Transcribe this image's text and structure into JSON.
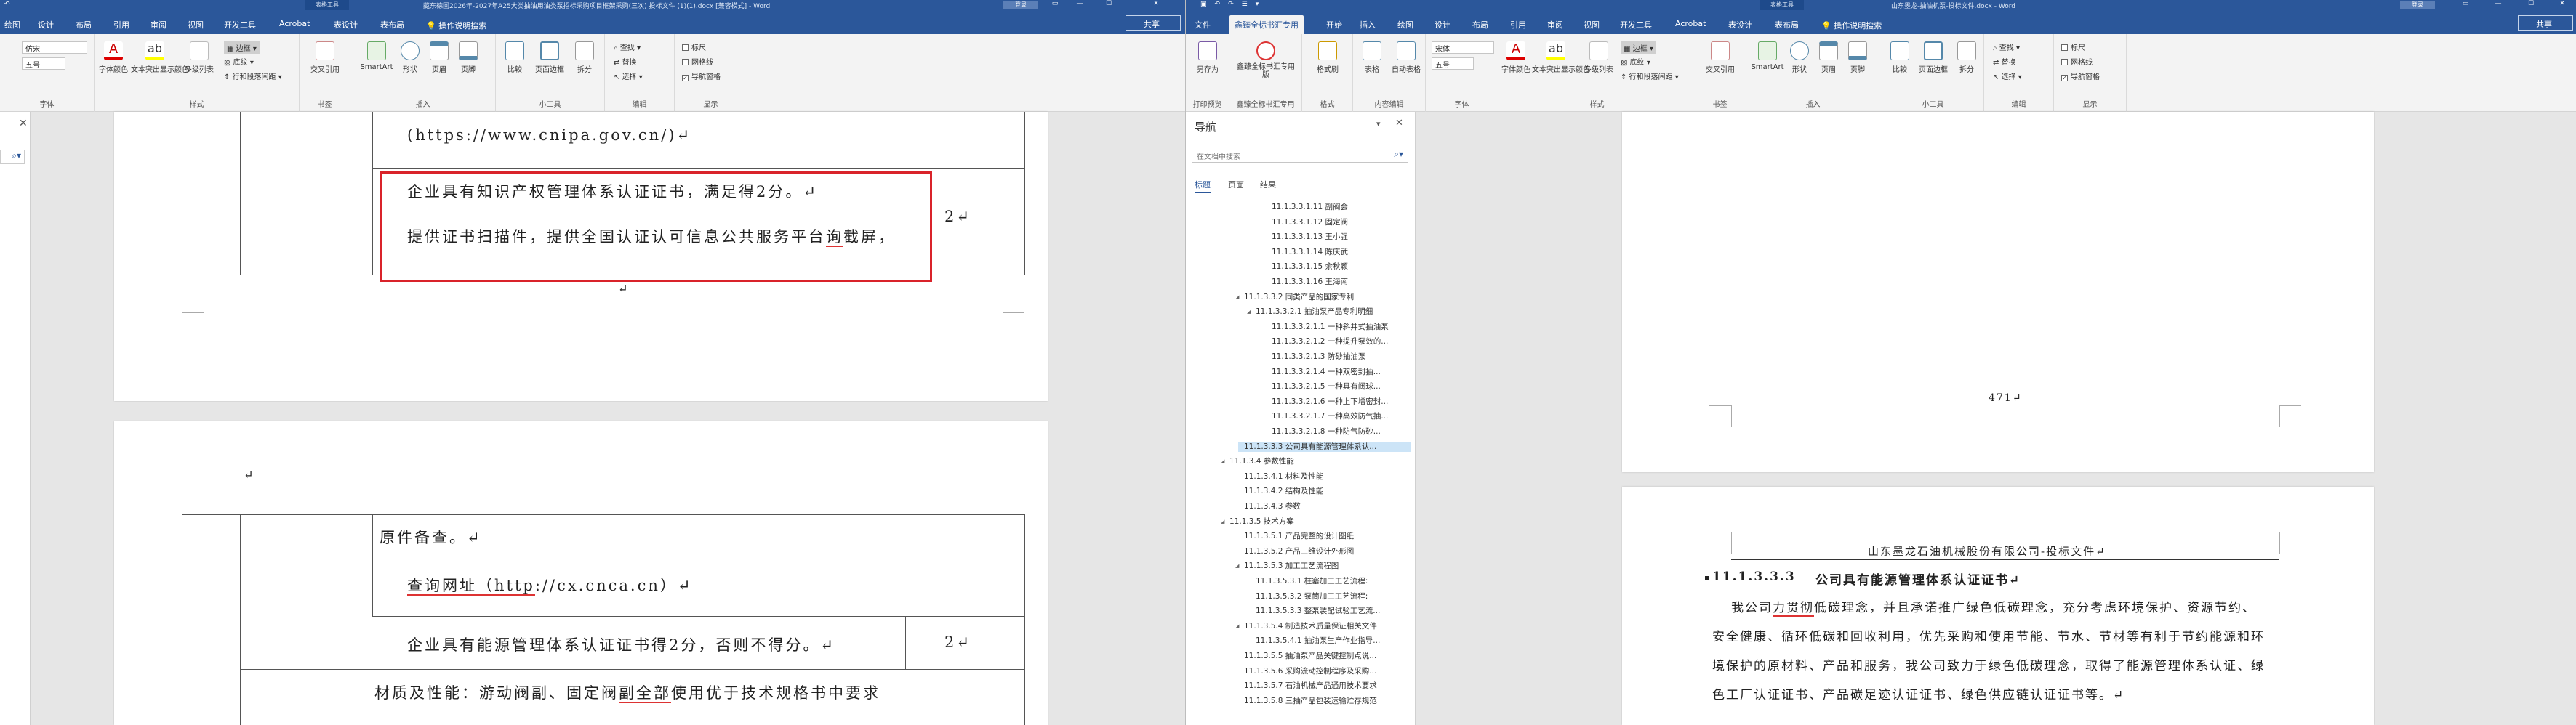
{
  "left_window": {
    "title": "藏东德回2026年-2027年A25大类抽油用油类泵招标采购项目框架采购(三次) 投标文件 (1)(1).docx [兼容模式] - Word",
    "table_tools": "表格工具",
    "login": "登录",
    "tabs": [
      "绘图",
      "设计",
      "布局",
      "引用",
      "审阅",
      "视图",
      "开发工具",
      "Acrobat",
      "表设计",
      "表布局"
    ],
    "tell_me": "操作说明搜索",
    "share": "共享",
    "font_name": "仿宋",
    "font_size": "五号",
    "ribbon": {
      "font_group": "字体",
      "para_group": "段落",
      "style_group": "样式",
      "insert_group": "插入",
      "tools_group": "小工具",
      "edit_group": "编辑",
      "show_group": "显示",
      "charshade": "字体颜色",
      "text_highlight": "文本突出显示颜色",
      "multi_list": "多级列表",
      "border": "边框",
      "shading": "底纹",
      "line_para_spacing": "行和段落间距",
      "cross_ref": "交叉引用",
      "smartart": "SmartArt",
      "shape": "形状",
      "header": "页眉",
      "footer": "页脚",
      "compare": "比较",
      "page_border": "页面边框",
      "split": "拆分",
      "find": "查找",
      "replace": "替换",
      "select": "选择",
      "ruler": "标尺",
      "gridlines": "网格线",
      "nav_pane": "导航窗格",
      "book_group": "书签"
    },
    "doc": {
      "url1": "(https://www.cnipa.gov.cn/)↵",
      "ip_line1": "企业具有知识产权管理体系认证证书，满足得2分。↵",
      "ip_line2_a": "提供证书扫描件，提供全国认证认可信息公共服务平台",
      "ip_line2_ul": "询",
      "ip_line2_b": "截屏，",
      "score1": "2↵",
      "para_mark": "↵",
      "orig_line": "原件备查。↵",
      "query_a": "查询网址（",
      "query_ul": "http",
      "query_b": "://cx.cnca.cn）↵",
      "energy_line": "企业具有能源管理体系认证证书得2分，否则不得分。↵",
      "score2": "2↵",
      "material_a": "材质及性能：游动阀副、固定阀",
      "material_ul": "副全部",
      "material_b": "使用优于技术规格书中要求"
    }
  },
  "right_window": {
    "title": "山东墨龙-抽油机泵-投标文件.docx - Word",
    "table_tools": "表格工具",
    "login": "登录",
    "tabs": [
      "文件",
      "鑫臻全标书汇专用",
      "开始",
      "插入",
      "绘图",
      "设计",
      "布局",
      "引用",
      "审阅",
      "视图",
      "开发工具",
      "Acrobat",
      "表设计",
      "表布局"
    ],
    "tell_me": "操作说明搜索",
    "share": "共享",
    "font_name": "宋体",
    "font_size": "五号",
    "ribbon": {
      "save_as": "另存为",
      "xz_btn": "鑫臻全标书汇专用版",
      "format_painter": "格式刷",
      "table": "表格",
      "auto_table": "自动表格",
      "file_group": "打印预览",
      "xz_group": "鑫臻全标书汇专用",
      "format_group": "格式",
      "content_group": "内容编辑"
    },
    "nav": {
      "title": "导航",
      "search_placeholder": "在文档中搜索",
      "tabs": [
        "标题",
        "页面",
        "结果"
      ],
      "items": [
        {
          "text": "11.1.3.3.1.11 副阀会",
          "level": 4
        },
        {
          "text": "11.1.3.3.1.12 固定阀",
          "level": 4
        },
        {
          "text": "11.1.3.3.1.13 王小强",
          "level": 4
        },
        {
          "text": "11.1.3.3.1.14 陈庆武",
          "level": 4
        },
        {
          "text": "11.1.3.3.1.15 余秋颖",
          "level": 4
        },
        {
          "text": "11.1.3.3.1.16 王海南",
          "level": 4
        },
        {
          "text": "11.1.3.3.2 同类产品的国家专利",
          "level": 2,
          "tri": "◢"
        },
        {
          "text": "11.1.3.3.2.1 抽油泵产品专利明细",
          "level": 3,
          "tri": "◢"
        },
        {
          "text": "11.1.3.3.2.1.1 一种斜井式抽油泵",
          "level": 4
        },
        {
          "text": "11.1.3.3.2.1.2 一种提升泵效的...",
          "level": 4
        },
        {
          "text": "11.1.3.3.2.1.3 防砂抽油泵",
          "level": 4
        },
        {
          "text": "11.1.3.3.2.1.4 一种双密封抽...",
          "level": 4
        },
        {
          "text": "11.1.3.3.2.1.5 一种具有阀球...",
          "level": 4
        },
        {
          "text": "11.1.3.3.2.1.6 一种上下增密封...",
          "level": 4
        },
        {
          "text": "11.1.3.3.2.1.7 一种高效防气抽...",
          "level": 4
        },
        {
          "text": "11.1.3.3.2.1.8 一种防气防砂...",
          "level": 4
        },
        {
          "text": "11.1.3.3.3 公司具有能源管理体系认...",
          "level": 2,
          "selected": true
        },
        {
          "text": "11.1.3.4 参数性能",
          "level": 1,
          "tri": "◢"
        },
        {
          "text": "11.1.3.4.1 材料及性能",
          "level": 2
        },
        {
          "text": "11.1.3.4.2 结构及性能",
          "level": 2
        },
        {
          "text": "11.1.3.4.3 参数",
          "level": 2
        },
        {
          "text": "11.1.3.5 技术方案",
          "level": 1,
          "tri": "◢"
        },
        {
          "text": "11.1.3.5.1 产品完整的设计图纸",
          "level": 2
        },
        {
          "text": "11.1.3.5.2 产品三维设计外形图",
          "level": 2
        },
        {
          "text": "11.1.3.5.3 加工工艺流程图",
          "level": 2,
          "tri": "◢"
        },
        {
          "text": "11.1.3.5.3.1 柱塞加工工艺流程:",
          "level": 3
        },
        {
          "text": "11.1.3.5.3.2 泵筒加工工艺流程:",
          "level": 3
        },
        {
          "text": "11.1.3.5.3.3 整泵装配试验工艺流...",
          "level": 3
        },
        {
          "text": "11.1.3.5.4 制造技术质量保证相关文件",
          "level": 2,
          "tri": "◢"
        },
        {
          "text": "11.1.3.5.4.1 抽油泵生产作业指导...",
          "level": 3
        },
        {
          "text": "11.1.3.5.5 抽油泵产品关键控制点说...",
          "level": 2
        },
        {
          "text": "11.1.3.5.6 采购流动控制程序及采购...",
          "level": 2
        },
        {
          "text": "11.1.3.5.7 石油机械产品通用技术要求",
          "level": 2
        },
        {
          "text": "11.1.3.5.8 三抽产品包装运输贮存规范",
          "level": 2
        }
      ]
    },
    "doc": {
      "page_number": "471↵",
      "header": "山东墨龙石油机械股份有限公司-投标文件↵",
      "heading_num": "11.1.3.3.3",
      "heading_text": "公司具有能源管理体系认证证书↵",
      "p1_a": "我公司",
      "p1_ul": "力贯彻",
      "p1_b": "低碳理念，并且承诺推广绿色低碳理念，充分考虑环境保护、资源节约、",
      "p2": "安全健康、循环低碳和回收利用，优先采购和使用节能、节水、节材等有利于节约能源和环",
      "p3": "境保护的原材料、产品和服务，我公司致力于绿色低碳理念，取得了能源管理体系认证、绿",
      "p4": "色工厂认证证书、产品碳足迹认证证书、绿色供应链认证证书等。↵"
    }
  },
  "colors": {
    "title_blue": "#2b579a",
    "ribbon_bg": "#f3f3f3",
    "red_box": "#d9232a",
    "selected": "#cce4f7"
  }
}
